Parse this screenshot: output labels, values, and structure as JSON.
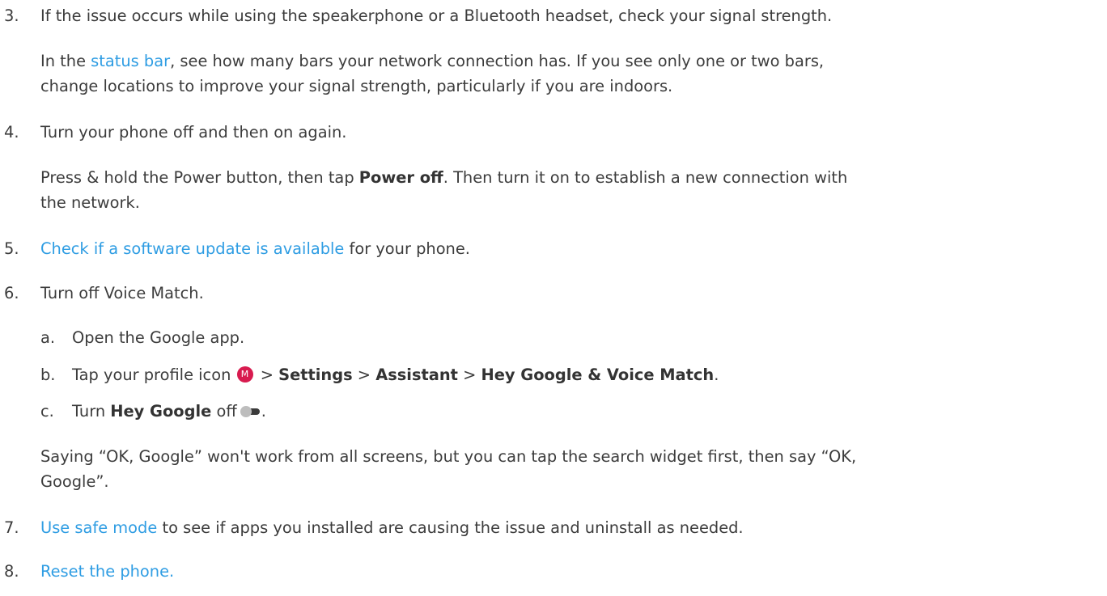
{
  "steps": {
    "s3": {
      "num": "3.",
      "text": "If the issue occurs while using the speakerphone or a Bluetooth headset, check your signal strength.",
      "detail_pre": "In the ",
      "detail_link": "status bar",
      "detail_post_line1": ", see how many bars your network connection has. If you see only one or two bars,",
      "detail_line2": "change locations to improve your signal strength, particularly if you are indoors."
    },
    "s4": {
      "num": "4.",
      "text": "Turn your phone off and then on again.",
      "detail_pre": "Press & hold the Power button, then tap ",
      "detail_bold": "Power off",
      "detail_post": ". Then turn it on to establish a new connection with",
      "detail_line2": "the network."
    },
    "s5": {
      "num": "5.",
      "link": "Check if a software update is available",
      "post": " for your phone."
    },
    "s6": {
      "num": "6.",
      "text": "Turn off Voice Match.",
      "a_num": "a.",
      "a_text": "Open the Google app.",
      "b_num": "b.",
      "b_pre": "Tap your profile icon ",
      "b_avatar": "M",
      "b_sep1": " > ",
      "b_bold1": "Settings",
      "b_sep2": " > ",
      "b_bold2": "Assistant",
      "b_sep3": " > ",
      "b_bold3": "Hey Google & Voice Match",
      "b_end": ".",
      "c_num": "c.",
      "c_pre": "Turn ",
      "c_bold": "Hey Google",
      "c_post": " off",
      "c_end": ".",
      "note_line1": "Saying “OK, Google” won't work from all screens, but you can tap the search widget first, then say “OK,",
      "note_line2": "Google”."
    },
    "s7": {
      "num": "7.",
      "link": "Use safe mode",
      "post": " to see if apps you installed are causing the issue and uninstall as needed."
    },
    "s8": {
      "num": "8.",
      "link": "Reset the phone."
    }
  },
  "colors": {
    "link": "#2f9de3",
    "text": "#3c3c3c",
    "avatar": "#d81b4f"
  },
  "icons": {
    "profile": "profile-avatar-icon",
    "toggle": "toggle-off-icon"
  }
}
